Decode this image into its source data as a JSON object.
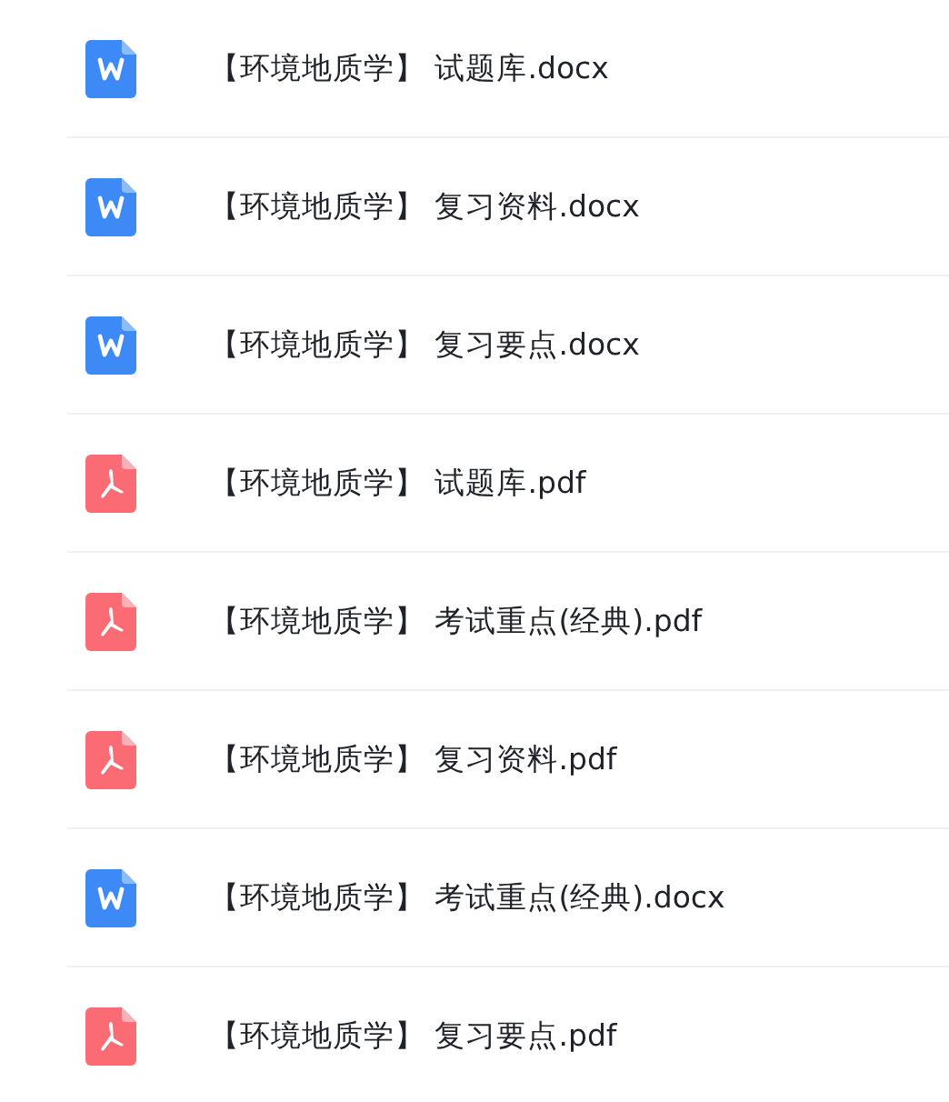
{
  "files": [
    {
      "kind": "word",
      "name": "【环境地质学】 试题库.docx"
    },
    {
      "kind": "word",
      "name": "【环境地质学】 复习资料.docx"
    },
    {
      "kind": "word",
      "name": "【环境地质学】 复习要点.docx"
    },
    {
      "kind": "pdf",
      "name": "【环境地质学】 试题库.pdf"
    },
    {
      "kind": "pdf",
      "name": "【环境地质学】 考试重点(经典).pdf"
    },
    {
      "kind": "pdf",
      "name": "【环境地质学】 复习资料.pdf"
    },
    {
      "kind": "word",
      "name": "【环境地质学】 考试重点(经典).docx"
    },
    {
      "kind": "pdf",
      "name": "【环境地质学】 复习要点.pdf"
    }
  ]
}
